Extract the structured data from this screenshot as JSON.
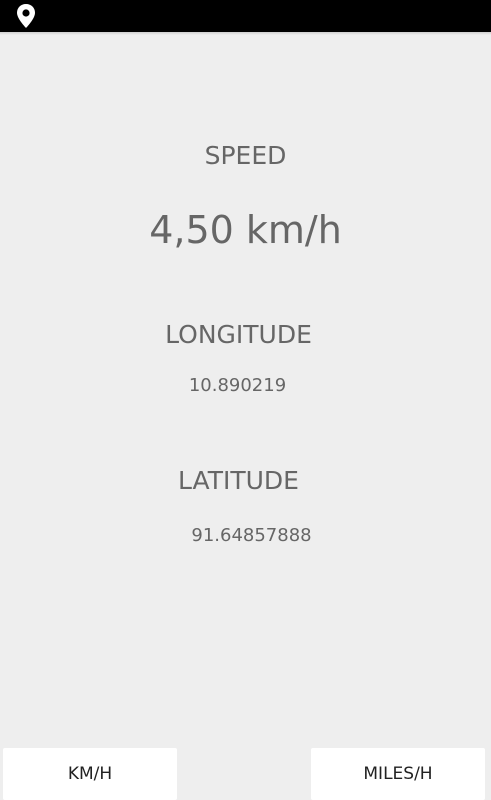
{
  "status_bar": {
    "icon": "location-pin-icon",
    "background": "#000000"
  },
  "speed": {
    "label": "SPEED",
    "value": "4,50 km/h"
  },
  "longitude": {
    "label": "LONGITUDE",
    "value": "10.890219"
  },
  "latitude": {
    "label": "LATITUDE",
    "value": "91.64857888"
  },
  "buttons": {
    "kmh": "KM/H",
    "mph": "MILES/H"
  },
  "colors": {
    "background": "#eeeeee",
    "text": "#666666",
    "button": "#ffffff"
  }
}
